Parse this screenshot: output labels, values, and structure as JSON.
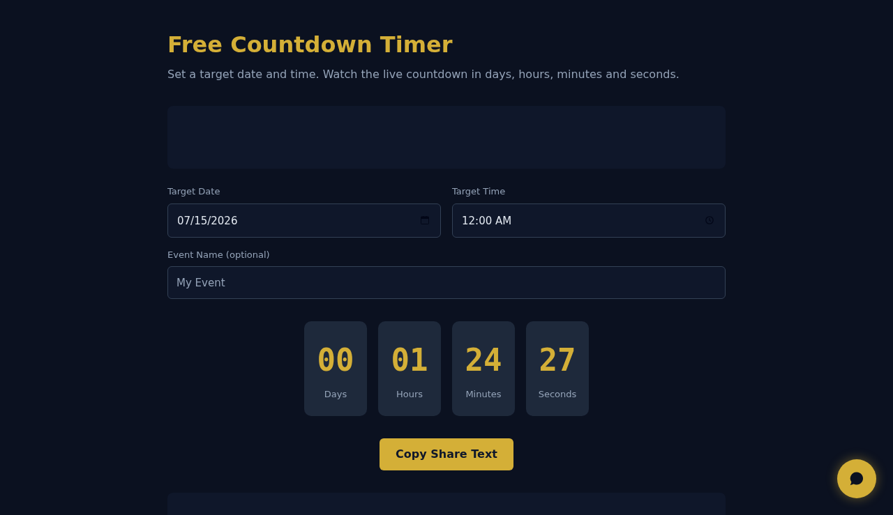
{
  "header": {
    "title": "Free Countdown Timer",
    "subtitle": "Set a target date and time. Watch the live countdown in days, hours, minutes and seconds."
  },
  "fields": [
    {
      "kind": "date",
      "label": "Target Date",
      "value": "07/15/2026"
    },
    {
      "kind": "time",
      "label": "Target Time",
      "value": "12:00 AM"
    }
  ],
  "event_name": {
    "label": "Event Name (optional)",
    "placeholder": "My Event"
  },
  "countdown": [
    {
      "value": "00",
      "unit": "Days"
    },
    {
      "value": "01",
      "unit": "Hours"
    },
    {
      "value": "24",
      "unit": "Minutes"
    },
    {
      "value": "27",
      "unit": "Seconds"
    }
  ],
  "share_button": {
    "label": "Copy Share Text"
  }
}
